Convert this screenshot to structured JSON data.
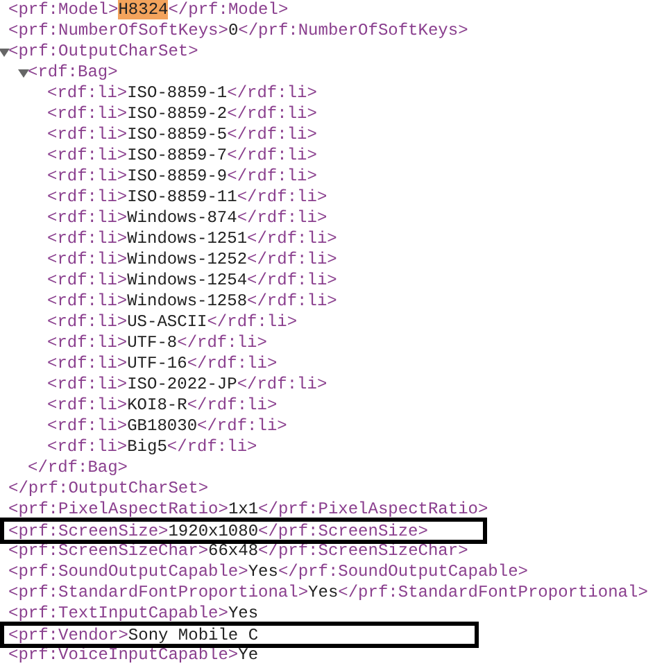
{
  "nodes": [
    {
      "open": "<prf:Model>",
      "value": "H8324",
      "value_highlighted": true,
      "close": "</prf:Model>"
    },
    {
      "open": "<prf:NumberOfSoftKeys>",
      "value": "0",
      "close": "</prf:NumberOfSoftKeys>"
    },
    {
      "open": "<prf:OutputCharSet>",
      "expanded": true,
      "close": "</prf:OutputCharSet>",
      "children": [
        {
          "open": "<rdf:Bag>",
          "expanded": true,
          "close": "</rdf:Bag>",
          "children": [
            {
              "open": "<rdf:li>",
              "value": "ISO-8859-1",
              "close": "</rdf:li>"
            },
            {
              "open": "<rdf:li>",
              "value": "ISO-8859-2",
              "close": "</rdf:li>"
            },
            {
              "open": "<rdf:li>",
              "value": "ISO-8859-5",
              "close": "</rdf:li>"
            },
            {
              "open": "<rdf:li>",
              "value": "ISO-8859-7",
              "close": "</rdf:li>"
            },
            {
              "open": "<rdf:li>",
              "value": "ISO-8859-9",
              "close": "</rdf:li>"
            },
            {
              "open": "<rdf:li>",
              "value": "ISO-8859-11",
              "close": "</rdf:li>"
            },
            {
              "open": "<rdf:li>",
              "value": "Windows-874",
              "close": "</rdf:li>"
            },
            {
              "open": "<rdf:li>",
              "value": "Windows-1251",
              "close": "</rdf:li>"
            },
            {
              "open": "<rdf:li>",
              "value": "Windows-1252",
              "close": "</rdf:li>"
            },
            {
              "open": "<rdf:li>",
              "value": "Windows-1254",
              "close": "</rdf:li>"
            },
            {
              "open": "<rdf:li>",
              "value": "Windows-1258",
              "close": "</rdf:li>"
            },
            {
              "open": "<rdf:li>",
              "value": "US-ASCII",
              "close": "</rdf:li>"
            },
            {
              "open": "<rdf:li>",
              "value": "UTF-8",
              "close": "</rdf:li>"
            },
            {
              "open": "<rdf:li>",
              "value": "UTF-16",
              "close": "</rdf:li>"
            },
            {
              "open": "<rdf:li>",
              "value": "ISO-2022-JP",
              "close": "</rdf:li>"
            },
            {
              "open": "<rdf:li>",
              "value": "KOI8-R",
              "close": "</rdf:li>"
            },
            {
              "open": "<rdf:li>",
              "value": "GB18030",
              "close": "</rdf:li>"
            },
            {
              "open": "<rdf:li>",
              "value": "Big5",
              "close": "</rdf:li>"
            }
          ]
        }
      ]
    },
    {
      "open": "<prf:PixelAspectRatio>",
      "value": "1x1",
      "close": "</prf:PixelAspectRatio>"
    },
    {
      "open": "<prf:ScreenSize>",
      "value": "1920x1080",
      "close": "</prf:ScreenSize>",
      "boxed": true
    },
    {
      "open": "<prf:ScreenSizeChar>",
      "value": "66x48",
      "close": "</prf:ScreenSizeChar>"
    },
    {
      "open": "<prf:SoundOutputCapable>",
      "value": "Yes",
      "close": "</prf:SoundOutputCapable>"
    },
    {
      "open": "<prf:StandardFontProportional>",
      "value": "Yes",
      "close": "</prf:StandardFontProportional>"
    },
    {
      "open": "<prf:TextInputCapable>",
      "value": "Yes"
    },
    {
      "open": "<prf:Vendor>",
      "value": "Sony Mobile C",
      "boxed": true
    },
    {
      "open": "<prf:VoiceInputCapable>",
      "value": "Ye"
    }
  ]
}
